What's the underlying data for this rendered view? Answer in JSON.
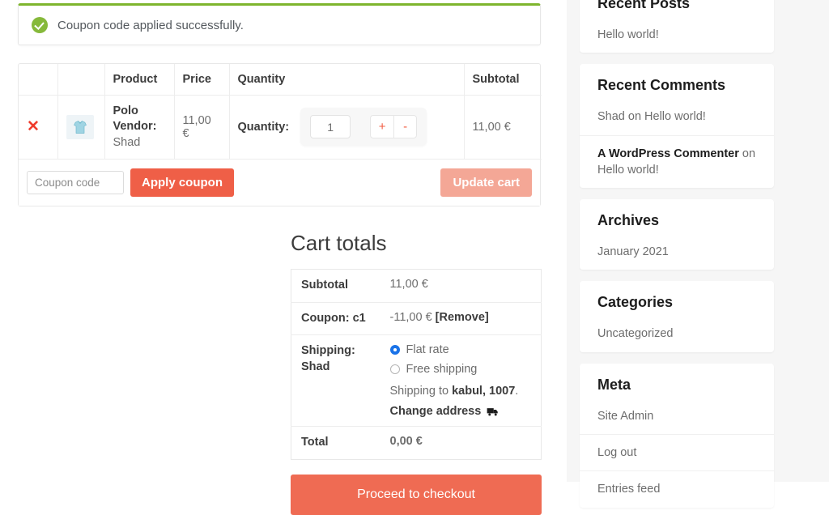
{
  "notice": {
    "icon": "success-check-icon",
    "message": "Coupon code applied successfully.",
    "accent_color": "#7eb52d"
  },
  "cart": {
    "headers": {
      "remove": "",
      "thumbnail": "",
      "product": "Product",
      "price": "Price",
      "quantity": "Quantity",
      "subtotal": "Subtotal"
    },
    "rows": [
      {
        "remove_icon": "remove-x-icon",
        "thumbnail_icon": "polo-shirt-thumbnail",
        "product_name": "Polo",
        "vendor_label": "Vendor:",
        "vendor_name": "Shad",
        "price": "11,00 €",
        "quantity_label": "Quantity:",
        "quantity_value": "1",
        "increase_label": "+",
        "decrease_label": "-",
        "subtotal": "11,00 €"
      }
    ],
    "coupon": {
      "placeholder": "Coupon code",
      "value": "",
      "apply_label": "Apply coupon",
      "update_label": "Update cart",
      "update_disabled": true,
      "apply_color": "#ef5f47",
      "update_color": "#f4a796"
    }
  },
  "totals": {
    "title": "Cart totals",
    "subtotal_label": "Subtotal",
    "subtotal_value": "11,00 €",
    "coupon_label": "Coupon: c1",
    "coupon_value": "-11,00 €",
    "coupon_remove": "[Remove]",
    "shipping_label": "Shipping:",
    "shipping_vendor": "Shad",
    "shipping_options": [
      {
        "label": "Flat rate",
        "selected": true
      },
      {
        "label": "Free shipping",
        "selected": false
      }
    ],
    "shipping_to_prefix": "Shipping to ",
    "shipping_to_address": "kabul, 1007",
    "shipping_to_suffix": ".",
    "change_address_label": "Change address",
    "change_address_icon": "delivery-truck-icon",
    "total_label": "Total",
    "total_value": "0,00 €",
    "checkout_label": "Proceed to checkout",
    "checkout_color": "#ef6b53",
    "radio_color": "#1a73e8"
  },
  "sidebar": {
    "widgets": [
      {
        "title": "Recent Posts",
        "items": [
          {
            "text": "Hello world!"
          }
        ]
      },
      {
        "title": "Recent Comments",
        "items": [
          {
            "text": "Shad on Hello world!"
          },
          {
            "bold": "A WordPress Commenter",
            "text": " on Hello world!"
          }
        ]
      },
      {
        "title": "Archives",
        "items": [
          {
            "text": "January 2021"
          }
        ]
      },
      {
        "title": "Categories",
        "items": [
          {
            "text": "Uncategorized"
          }
        ]
      },
      {
        "title": "Meta",
        "items": [
          {
            "text": "Site Admin"
          },
          {
            "text": "Log out"
          },
          {
            "text": "Entries feed"
          }
        ]
      }
    ]
  }
}
